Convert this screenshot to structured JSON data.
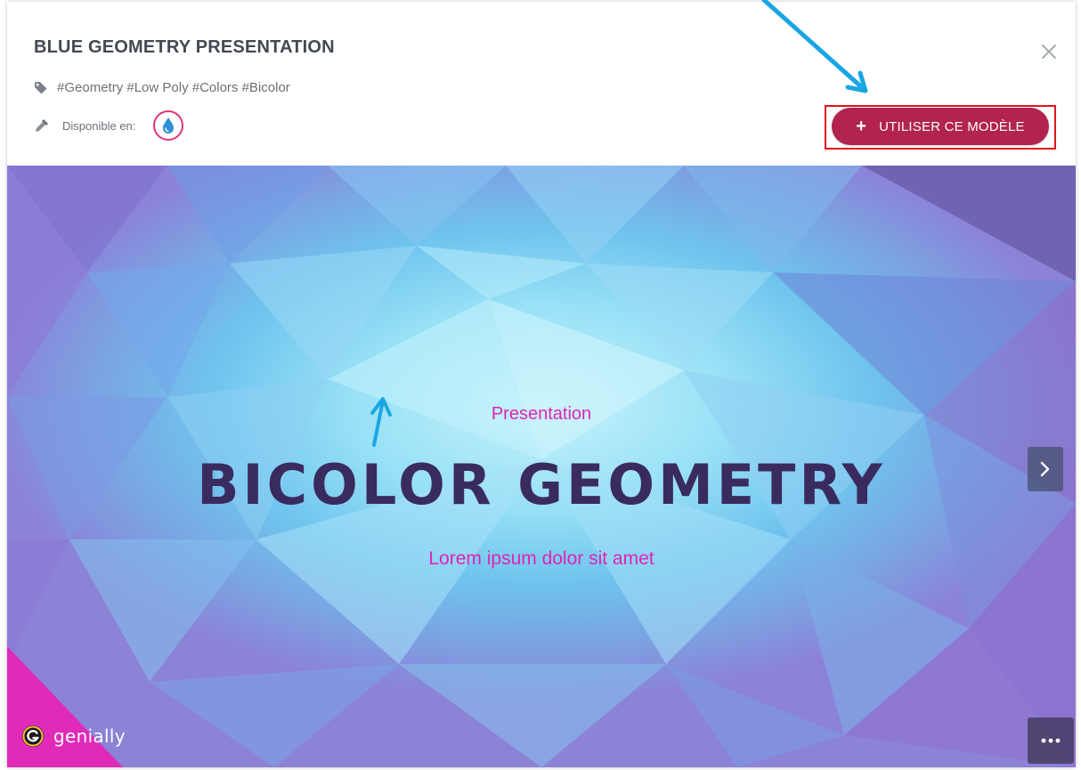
{
  "header": {
    "title": "BLUE GEOMETRY PRESENTATION",
    "tags": "#Geometry #Low Poly #Colors #Bicolor",
    "available_label": "Disponible en:",
    "use_button_label": "UTILISER CE MODÈLE",
    "use_button_icon": "plus-icon",
    "close_icon": "close-icon"
  },
  "slide": {
    "subtitle_top": "Presentation",
    "title": "BICOLOR GEOMETRY",
    "lorem": "Lorem ipsum dolor sit amet",
    "brand": "genially",
    "next_icon": "chevron-right-icon",
    "more_icon": "more-dots-icon"
  },
  "colors": {
    "title_text": "#434952",
    "button_bg": "#b2234f",
    "button_outline": "#e0141e",
    "accent_pink": "#e024b6",
    "slide_title": "#3a2b5e",
    "annotation_arrow": "#1aa6e4"
  }
}
